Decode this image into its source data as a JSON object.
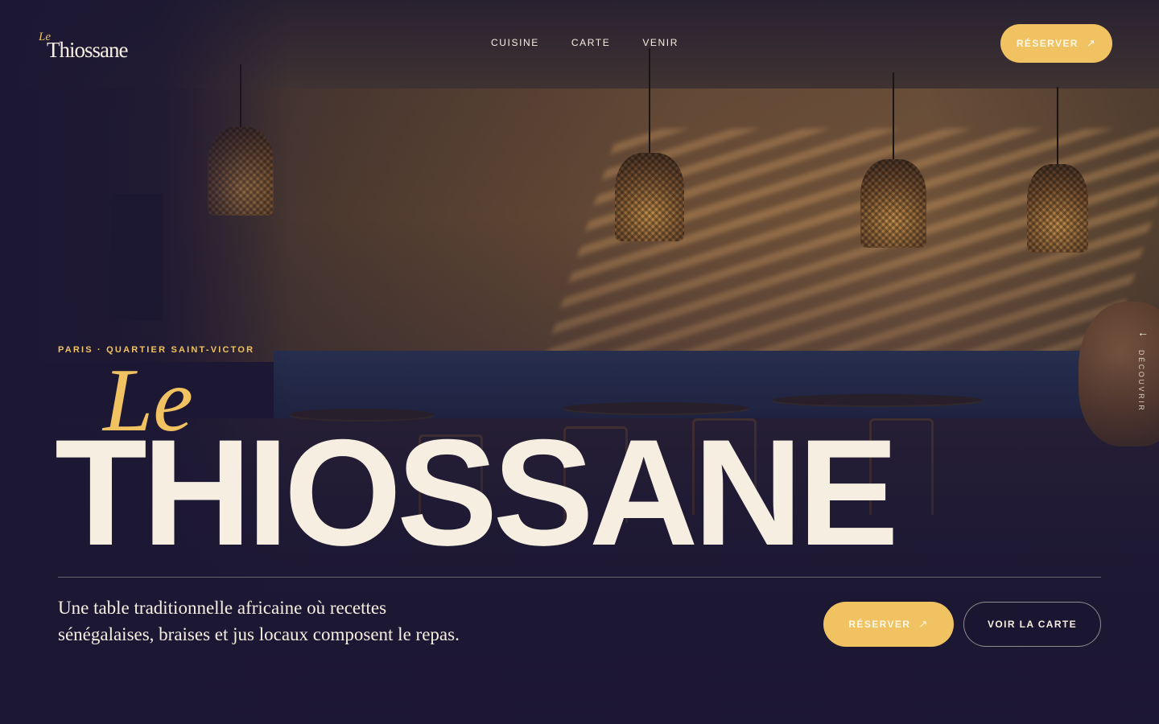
{
  "brand": {
    "le": "Le",
    "name": "Thiossane"
  },
  "nav": {
    "items": [
      "CUISINE",
      "CARTE",
      "VENIR"
    ]
  },
  "header": {
    "reserve_label": "RÉSERVER",
    "reserve_icon": "arrow-up-right-icon"
  },
  "side": {
    "discover_label": "DÉCOUVRIR",
    "icon": "arrow-left-icon"
  },
  "hero": {
    "eyebrow": "PARIS · QUARTIER SAINT-VICTOR",
    "title_le": "Le",
    "title": "THIOSSANE",
    "tagline_line1": "Une table traditionnelle africaine où recettes",
    "tagline_line2": "sénégalaises, braises et jus locaux composent le repas.",
    "reserve_label": "RÉSERVER",
    "menu_label": "VOIR LA CARTE"
  },
  "colors": {
    "accent": "#f0c261",
    "cream": "#f6efe1",
    "night": "#1c1733"
  }
}
